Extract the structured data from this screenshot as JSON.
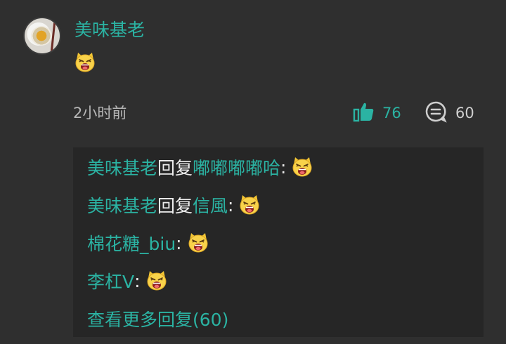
{
  "comment": {
    "username": "美味基老",
    "emoji_name": "laughing-cat-emoji",
    "timestamp": "2小时前",
    "like_count": "76",
    "comment_count": "60"
  },
  "replies": [
    {
      "author": "美味基老",
      "reply_word": "回复",
      "target": "嘟嘟嘟嘟哈",
      "colon": ":"
    },
    {
      "author": "美味基老",
      "reply_word": "回复",
      "target": "信風",
      "colon": ":"
    },
    {
      "author": "棉花糖_biu",
      "colon": ":"
    },
    {
      "author": "李杠V",
      "colon": ":"
    }
  ],
  "more_replies_label": "查看更多回复(60)",
  "colors": {
    "background": "#2f2f2f",
    "reply_background": "#262626",
    "accent": "#2bb3a3",
    "text_muted": "#b7b7b7"
  },
  "icons": {
    "like": "thumbs-up-icon",
    "comment": "comment-bubble-icon"
  }
}
